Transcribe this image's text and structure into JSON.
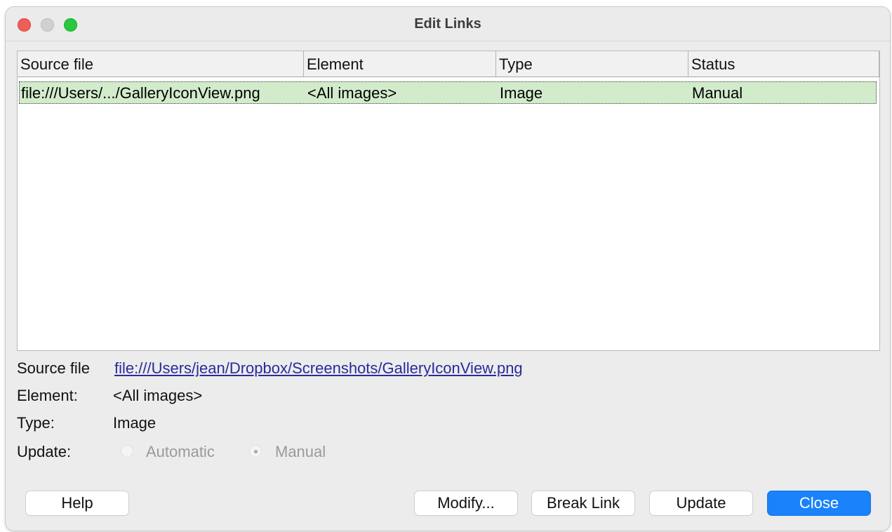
{
  "window": {
    "title": "Edit Links"
  },
  "table": {
    "columns": [
      "Source file",
      "Element",
      "Type",
      "Status"
    ],
    "rows": [
      {
        "source": "file:///Users/.../GalleryIconView.png",
        "element": "<All images>",
        "type": "Image",
        "status": "Manual"
      }
    ]
  },
  "details": {
    "source_label": "Source file",
    "source_value": "file:///Users/jean/Dropbox/Screenshots/GalleryIconView.png",
    "element_label": "Element:",
    "element_value": "<All images>",
    "type_label": "Type:",
    "type_value": "Image",
    "update_label": "Update:",
    "update_options": [
      "Automatic",
      "Manual"
    ],
    "update_selected": "Manual"
  },
  "buttons": {
    "help": "Help",
    "modify": "Modify...",
    "break_link": "Break Link",
    "update": "Update",
    "close": "Close"
  },
  "colors": {
    "selected_row": "#d2eccb",
    "accent_button": "#1a82fb",
    "link": "#2a2a9c"
  }
}
